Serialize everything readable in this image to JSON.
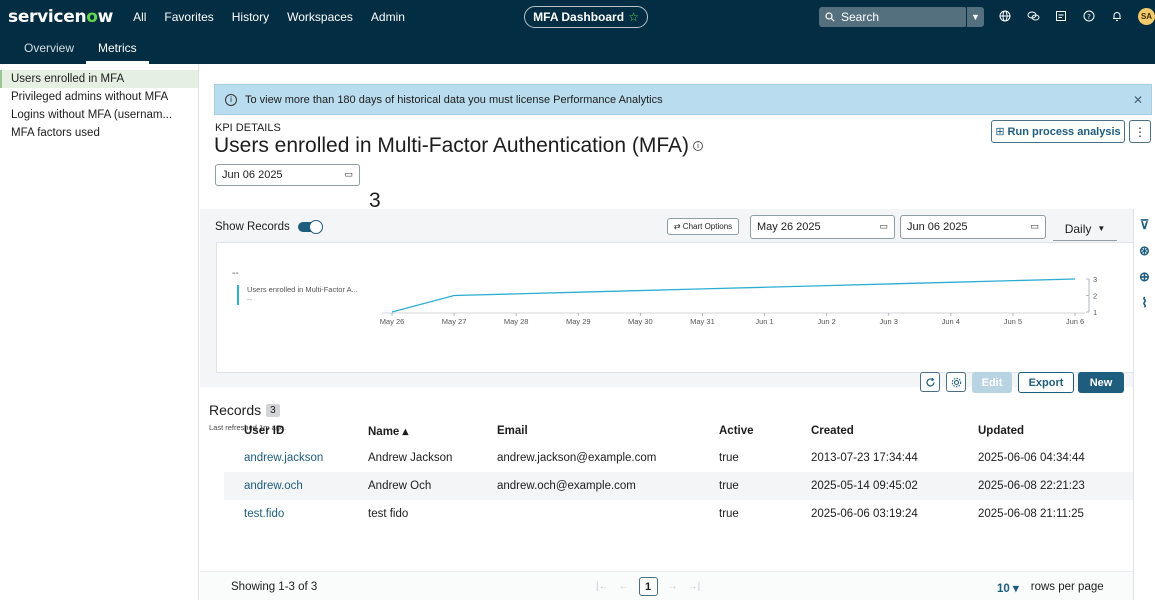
{
  "topnav": {
    "logo_prefix": "servicen",
    "logo_o": "o",
    "logo_suffix": "w",
    "menu": [
      "All",
      "Favorites",
      "History",
      "Workspaces",
      "Admin"
    ],
    "dashboard_pill": "MFA Dashboard",
    "star_icon": "☆",
    "search_placeholder": "Search",
    "avatar_initials": "SA"
  },
  "subnav": {
    "tabs": [
      "Overview",
      "Metrics"
    ]
  },
  "sidebar": {
    "items": [
      "Users enrolled in MFA",
      "Privileged admins without MFA",
      "Logins without MFA (usernam...",
      "MFA factors used"
    ]
  },
  "banner": {
    "text": "To view more than 180 days of historical data you must license Performance Analytics"
  },
  "kpi": {
    "label": "KPI DETAILS",
    "title": "Users enrolled in Multi-Factor Authentication (MFA)",
    "date": "Jun 06 2025",
    "value": "3",
    "run_button": "Run process analysis"
  },
  "chart_panel": {
    "show_records_label": "Show Records",
    "chart_options_label": "⇄ Chart Options",
    "start_date": "May 26 2025",
    "end_date": "Jun 06 2025",
    "granularity": "Daily",
    "legend_dash": "--",
    "legend_name": "Users enrolled in Multi-Factor A...",
    "legend_sub": "--"
  },
  "chart_data": {
    "type": "line",
    "x": [
      "May 26",
      "May 27",
      "May 28",
      "May 29",
      "May 30",
      "May 31",
      "Jun 1",
      "Jun 2",
      "Jun 3",
      "Jun 4",
      "Jun 5",
      "Jun 6"
    ],
    "series": [
      {
        "name": "Users enrolled in Multi-Factor A...",
        "values": [
          1,
          2,
          2.1,
          2.2,
          2.3,
          2.4,
          2.5,
          2.6,
          2.7,
          2.8,
          2.9,
          3
        ]
      }
    ],
    "y_ticks": [
      1,
      2,
      3
    ],
    "ylim": [
      1,
      3
    ],
    "color": "#2eadd4"
  },
  "records": {
    "title": "Records",
    "count": "3",
    "last_refreshed": "Last refreshed 1m ago.",
    "buttons": {
      "edit": "Edit",
      "export": "Export",
      "new": "New"
    },
    "columns": [
      "User ID",
      "Name ▴",
      "Email",
      "Active",
      "Created",
      "Updated"
    ],
    "rows": [
      [
        "andrew.jackson",
        "Andrew Jackson",
        "andrew.jackson@example.com",
        "true",
        "2013-07-23 17:34:44",
        "2025-06-06 04:34:44"
      ],
      [
        "andrew.och",
        "Andrew Och",
        "andrew.och@example.com",
        "true",
        "2025-05-14 09:45:02",
        "2025-06-08 22:21:23"
      ],
      [
        "test.fido",
        "test fido",
        "",
        "true",
        "2025-06-06 03:19:24",
        "2025-06-08 21:11:25"
      ]
    ]
  },
  "footer": {
    "showing": "Showing 1-3 of 3",
    "page": "1",
    "rows_per_page_value": "10",
    "rows_per_page_label": "rows per page"
  }
}
